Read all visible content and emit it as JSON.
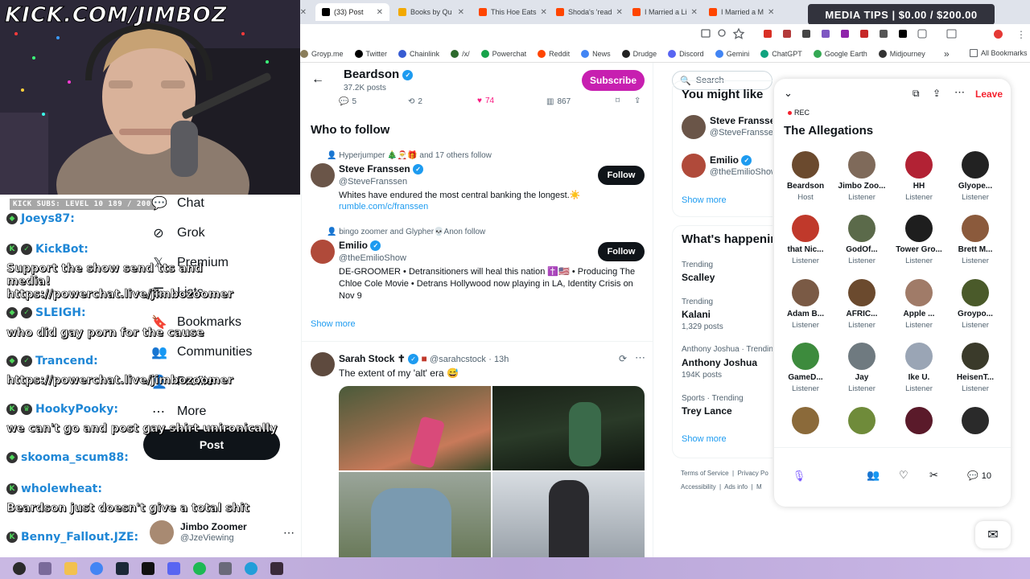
{
  "browser": {
    "tabs": [
      {
        "label": "d",
        "color": "#7b61ff"
      },
      {
        "label": "(33) Post",
        "color": "#000000",
        "active": true
      },
      {
        "label": "Books by Qu",
        "color": "#f2a900"
      },
      {
        "label": "This Hoe Eats",
        "color": "#ff4500"
      },
      {
        "label": "Shoda's 'read",
        "color": "#ff4500"
      },
      {
        "label": "I Married a Li",
        "color": "#ff4500"
      },
      {
        "label": "I Married a M",
        "color": "#ff4500"
      }
    ],
    "bookmarks": [
      {
        "label": "Groyp.me",
        "color": "#8a7d5a"
      },
      {
        "label": "Twitter",
        "color": "#000000"
      },
      {
        "label": "Chainlink",
        "color": "#375bd2"
      },
      {
        "label": "/x/",
        "color": "#2d6a2d"
      },
      {
        "label": "Powerchat",
        "color": "#17a34a"
      },
      {
        "label": "Reddit",
        "color": "#ff4500"
      },
      {
        "label": "News",
        "color": "#4285f4"
      },
      {
        "label": "Drudge",
        "color": "#222222"
      },
      {
        "label": "Discord",
        "color": "#5865f2"
      },
      {
        "label": "Gemini",
        "color": "#4285f4"
      },
      {
        "label": "ChatGPT",
        "color": "#10a37f"
      },
      {
        "label": "Google Earth",
        "color": "#34a853"
      },
      {
        "label": "Midjourney",
        "color": "#333333"
      }
    ],
    "all_bookmarks": "All Bookmarks",
    "more_chevron": "»"
  },
  "stream": {
    "title": "KICK.COM/JIMBOZ",
    "subs": "KICK SUBS: LEVEL 10 189 / 200",
    "media_tips": "MEDIA TIPS | $0.00 / $200.00",
    "chat": [
      {
        "name": "Joeys87:",
        "msg": ""
      },
      {
        "name": "KickBot:",
        "msg": "Support the show send tts and media! https://powerchat.live/jimbozoomer"
      },
      {
        "name": "SLEIGH:",
        "msg": "who did gay porn for the cause"
      },
      {
        "name": "Trancend:",
        "msg": "https://powerchat.live/jimbozoomer"
      },
      {
        "name": "HookyPooky:",
        "msg": "we can't go and post gay shirt unironically"
      },
      {
        "name": "skooma_scum88:",
        "msg": ""
      },
      {
        "name": "wholewheat:",
        "msg": "Beardson just doesn't give a total shit"
      },
      {
        "name": "Benny_Fallout.JZE:",
        "msg": ""
      }
    ]
  },
  "nav": {
    "items": [
      {
        "label": "Chat",
        "icon": "chat-icon"
      },
      {
        "label": "Grok",
        "icon": "grok-icon"
      },
      {
        "label": "Premium",
        "icon": "x-logo-icon"
      },
      {
        "label": "Lists",
        "icon": "lists-icon"
      },
      {
        "label": "Bookmarks",
        "icon": "bookmark-icon"
      },
      {
        "label": "Communities",
        "icon": "communities-icon"
      },
      {
        "label": "Profile",
        "icon": "profile-icon"
      },
      {
        "label": "More",
        "icon": "more-icon"
      }
    ],
    "post_label": "Post",
    "account_name": "Jimbo Zoomer",
    "account_handle": "@JzeViewing"
  },
  "header": {
    "name": "Beardson",
    "posts": "37.2K posts",
    "subscribe": "Subscribe"
  },
  "actions": {
    "replies": "5",
    "reposts": "2",
    "likes": "74",
    "views": "867"
  },
  "who_to_follow": {
    "title": "Who to follow",
    "items": [
      {
        "social": "Hyperjumper 🎄🎅🎁 and 17 others follow",
        "name": "Steve Franssen",
        "handle": "@SteveFranssen",
        "bio": "Whites have endured the most central banking the longest.☀️",
        "link": "rumble.com/c/franssen",
        "follow": "Follow"
      },
      {
        "social": "bingo zoomer and Glypher💀Anon follow",
        "name": "Emilio",
        "handle": "@theEmilioShow",
        "bio": "DE-GROOMER • Detransitioners will heal this nation ✝️🇺🇸 • Producing The Chloe Cole Movie • Detrans Hollywood now playing in LA, Identity Crisis on Nov 9",
        "link": "",
        "follow": "Follow"
      }
    ],
    "show_more": "Show more"
  },
  "tweet": {
    "name": "Sarah Stock ✝",
    "handle": "@sarahcstock",
    "time": "· 13h",
    "text": "The extent of my 'alt' era 😅"
  },
  "sidebar": {
    "search": "Search",
    "you_might_like": "You might like",
    "suggestions": [
      {
        "name": "Steve Franssen",
        "handle": "@SteveFranssen"
      },
      {
        "name": "Emilio",
        "handle": "@theEmilioShow"
      }
    ],
    "show_more": "Show more",
    "happening_title": "What's happening",
    "trends": [
      {
        "meta": "Trending",
        "name": "Scalley",
        "count": ""
      },
      {
        "meta": "Trending",
        "name": "Kalani",
        "count": "1,329 posts"
      },
      {
        "meta": "Anthony Joshua · Trending",
        "name": "Anthony Joshua",
        "count": "194K posts"
      },
      {
        "meta": "Sports · Trending",
        "name": "Trey Lance",
        "count": ""
      }
    ],
    "show_more2": "Show more",
    "footer": [
      "Terms of Service",
      "Privacy Po",
      "Accessibility",
      "Ads info",
      "M"
    ]
  },
  "spaces": {
    "leave": "Leave",
    "rec": "REC",
    "title": "The Allegations",
    "participants": [
      {
        "name": "Beardson",
        "role": "Host",
        "color": "#6b4a2e"
      },
      {
        "name": "Jimbo Zoo...",
        "role": "Listener",
        "color": "#7f6a5a"
      },
      {
        "name": "HH",
        "role": "Listener",
        "color": "#b22234"
      },
      {
        "name": "Glyope...",
        "role": "Listener",
        "color": "#222222"
      },
      {
        "name": "that Nic...",
        "role": "Listener",
        "color": "#c0392b"
      },
      {
        "name": "GodOf...",
        "role": "Listener",
        "color": "#5b6a4a"
      },
      {
        "name": "Tower Gro...",
        "role": "Listener",
        "color": "#1e1e1e"
      },
      {
        "name": "Brett M...",
        "role": "Listener",
        "color": "#8b5a3c"
      },
      {
        "name": "Adam B...",
        "role": "Listener",
        "color": "#7a5a45"
      },
      {
        "name": "AFRIC...",
        "role": "Listener",
        "color": "#6b4a2e"
      },
      {
        "name": "Apple ...",
        "role": "Listener",
        "color": "#a07b68"
      },
      {
        "name": "Groypo...",
        "role": "Listener",
        "color": "#4a5a2a"
      },
      {
        "name": "GameD...",
        "role": "Listener",
        "color": "#3d8b3d"
      },
      {
        "name": "Jay",
        "role": "Listener",
        "color": "#6f7a80"
      },
      {
        "name": "Ike U.",
        "role": "Listener",
        "color": "#9aa5b5"
      },
      {
        "name": "HeisenT...",
        "role": "Listener",
        "color": "#3a3a2a"
      },
      {
        "name": "",
        "role": "",
        "color": "#8b6a3a"
      },
      {
        "name": "",
        "role": "",
        "color": "#6f8b3a"
      },
      {
        "name": "",
        "role": "",
        "color": "#5a1a2a"
      },
      {
        "name": "",
        "role": "",
        "color": "#2a2a2a"
      }
    ],
    "comments": "10"
  },
  "colors": {
    "accent": "#1d9bf0",
    "subscribe": "#c71fb0",
    "leave": "#f4212e",
    "heart": "#f91880"
  }
}
